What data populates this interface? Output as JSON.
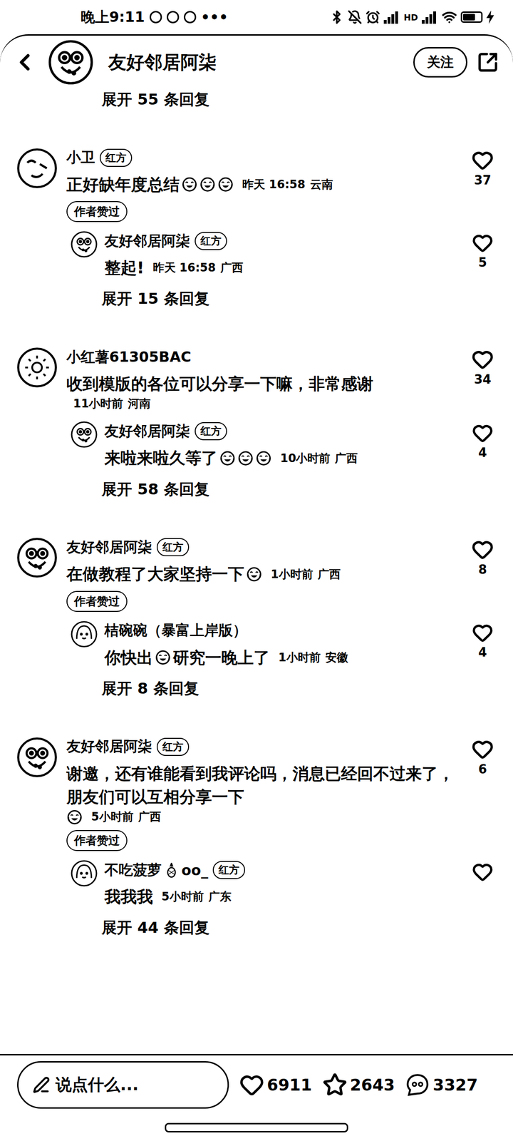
{
  "status_bar": {
    "time": "晚上9:11",
    "more": "•••",
    "network": "HD",
    "battery": {
      "level": 0.7,
      "charging": true
    }
  },
  "header": {
    "name": "友好邻居阿柒",
    "follow": "关注"
  },
  "top_more": "展开 55 条回复",
  "threads": [
    {
      "comment": {
        "author": [
          {
            "kind": "text",
            "text": "小卫"
          }
        ],
        "badge": "红方",
        "avatar": "face",
        "parts": [
          {
            "kind": "text",
            "text": "正好缺年度总结"
          },
          {
            "kind": "emoji"
          },
          {
            "kind": "emoji"
          },
          {
            "kind": "emoji"
          }
        ],
        "time": "昨天 16:58",
        "location": "云南",
        "likes": "37",
        "liked": false,
        "author_liked": "作者赞过"
      },
      "reply": {
        "author": [
          {
            "kind": "text",
            "text": "友好邻居阿柒"
          }
        ],
        "badge": "红方",
        "avatar": "owl",
        "parts": [
          {
            "kind": "text",
            "text": "整起!"
          }
        ],
        "time": "昨天 16:58",
        "location": "广西",
        "likes": "5",
        "liked": false
      },
      "more": "展开 15 条回复"
    },
    {
      "comment": {
        "author": [
          {
            "kind": "text",
            "text": "小红薯61305BAC"
          }
        ],
        "badge": "",
        "avatar": "sun",
        "parts": [
          {
            "kind": "text",
            "text": "收到模版的各位可以分享一下嘛，非常感谢"
          }
        ],
        "time": "11小时前",
        "location": "河南",
        "likes": "34",
        "liked": false,
        "author_liked": ""
      },
      "reply": {
        "author": [
          {
            "kind": "text",
            "text": "友好邻居阿柒"
          }
        ],
        "badge": "红方",
        "avatar": "owl",
        "parts": [
          {
            "kind": "text",
            "text": "来啦来啦久等了"
          },
          {
            "kind": "emoji"
          },
          {
            "kind": "emoji"
          },
          {
            "kind": "emoji"
          }
        ],
        "time": "10小时前",
        "location": "广西",
        "likes": "4",
        "liked": false
      },
      "more": "展开 58 条回复"
    },
    {
      "comment": {
        "author": [
          {
            "kind": "text",
            "text": "友好邻居阿柒"
          }
        ],
        "badge": "红方",
        "avatar": "owl",
        "parts": [
          {
            "kind": "text",
            "text": "在做教程了大家坚持一下"
          },
          {
            "kind": "emoji"
          }
        ],
        "time": "1小时前",
        "location": "广西",
        "likes": "8",
        "liked": false,
        "author_liked": "作者赞过"
      },
      "reply": {
        "author": [
          {
            "kind": "text",
            "text": "桔碗碗（暴富上岸版）"
          }
        ],
        "badge": "",
        "avatar": "girl",
        "parts": [
          {
            "kind": "text",
            "text": "你快出"
          },
          {
            "kind": "emoji"
          },
          {
            "kind": "text",
            "text": "研究一晚上了"
          }
        ],
        "time": "1小时前",
        "location": "安徽",
        "likes": "4",
        "liked": false
      },
      "more": "展开 8 条回复"
    },
    {
      "comment": {
        "author": [
          {
            "kind": "text",
            "text": "友好邻居阿柒"
          }
        ],
        "badge": "红方",
        "avatar": "owl",
        "parts": [
          {
            "kind": "text",
            "text": "谢邀，还有谁能看到我评论吗，消息已经回不过来了，朋友们可以互相分享一下"
          },
          {
            "kind": "emoji"
          }
        ],
        "time": "5小时前",
        "location": "广西",
        "likes": "6",
        "liked": false,
        "author_liked": "作者赞过"
      },
      "reply": {
        "author": [
          {
            "kind": "text",
            "text": "不吃菠萝"
          },
          {
            "kind": "pineapple"
          },
          {
            "kind": "text",
            "text": "oo_"
          }
        ],
        "badge": "红方",
        "avatar": "girl",
        "parts": [
          {
            "kind": "text",
            "text": "我我我"
          }
        ],
        "time": "5小时前",
        "location": "广东",
        "likes": "",
        "liked": false
      },
      "more": "展开 44 条回复"
    }
  ],
  "bottom_bar": {
    "placeholder": "说点什么...",
    "actions": [
      {
        "kind": "like",
        "count": "6911"
      },
      {
        "kind": "collect",
        "count": "2643"
      },
      {
        "kind": "comment",
        "count": "3327"
      }
    ]
  }
}
